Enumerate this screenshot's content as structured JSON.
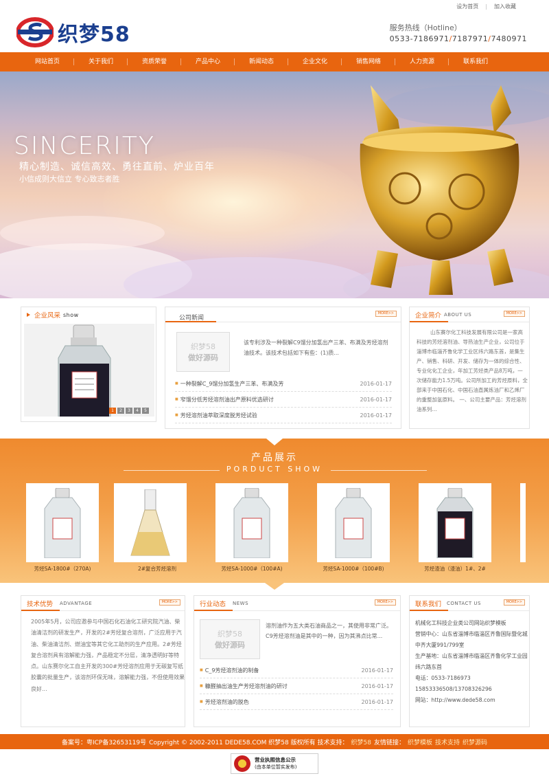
{
  "topbar": {
    "home": "设为首页",
    "fav": "加入收藏"
  },
  "logo": {
    "text": "织梦58"
  },
  "hotline": {
    "label": "服务热线（Hotline）",
    "prefix": "0533-",
    "n1": "7186971",
    "n2": "7187971",
    "n3": "7480971"
  },
  "nav": [
    "网站首页",
    "关于我们",
    "资质荣誉",
    "产品中心",
    "新闻动态",
    "企业文化",
    "销售网络",
    "人力资源",
    "联系我们"
  ],
  "banner": {
    "title": "SINCERITY",
    "sub1": "精心制造、诚信高效、勇往直前、炉业百年",
    "sub2": "小信成则大信立 专心致志者胜"
  },
  "show": {
    "title": "企业风采",
    "en": "show",
    "pages": [
      "1",
      "2",
      "3",
      "4",
      "5"
    ]
  },
  "news": {
    "title": "公司新闻",
    "more": "MORE>>",
    "thumb1": "织梦58",
    "thumb2": "做好源码",
    "desc": "该专利涉及一种裂解C9馏分加氢出产三苯、布满及芳烃溶剂油技术。该技术包括如下有些：(1)质...",
    "items": [
      {
        "t": "一种裂解C_9馏分加氢生产三苯、布满及芳",
        "d": "2016-01-17"
      },
      {
        "t": "窄馏分低芳烃溶剂油出产原料优选研讨",
        "d": "2016-01-17"
      },
      {
        "t": "芳烃溶剂油萃取深度脱芳烃试验",
        "d": "2016-01-17"
      }
    ]
  },
  "about": {
    "title": "企业简介",
    "en": "ABOUT US",
    "more": "MORE>>",
    "text": "山东赛尔化工科技发展有限公司是一家高科技的芳烃溶剂油、导热油生产企业，公司位于淄博市临淄齐鲁化学工业区纬六路东首，是集生产、销售、科研、开发、储存为一体的综合性、专业化化工企业，年加工芳烃类产品8万吨，一次储存能力1.5万吨。公司所加工的芳烃原料，全部来于中国石化、中国石油直属炼油厂和乙烯厂的重整加氢原料。 一、公司主要产品：芳烃溶剂油系列..."
  },
  "products": {
    "title": "产品展示",
    "en": "PORDUCT SHOW",
    "items": [
      {
        "name": "芳烃SA-1800#（270A)"
      },
      {
        "name": "2#复合芳烃溶剂"
      },
      {
        "name": "芳烃SA-1000#（100#A)"
      },
      {
        "name": "芳烃SA-1000#（100#B)"
      },
      {
        "name": "芳烃渣油（渣油）1#、2#"
      }
    ]
  },
  "adv": {
    "title": "技术优势",
    "en": "ADVANTAGE",
    "more": "MORE>>",
    "text": "2005年5月，公司应邀参与中国石化石油化工研究院汽油、柴油清洁剂的研发生产，开发的2#芳烃复合溶剂，广泛应用于汽油、柴油清洁剂、燃油宝等其它化工助剂的生产应用。2#芳烃复合溶剂具有溶解能力强，产品稳定不分层，清净透明好等特点。山东赛尔化工自主开发的300#芳烃溶剂应用于无碳复写纸胶囊的批量生产，该溶剂环保无味，溶解能力强，不但使用效果良好..."
  },
  "industry": {
    "title": "行业动态",
    "en": "NEWS",
    "more": "MORE>>",
    "thumb1": "织梦58",
    "thumb2": "做好源码",
    "desc": "溶剂油作为五大类石油商品之一，其使用非常广泛。C9芳烃溶剂油是其中的一种，因为其沸点比常...",
    "items": [
      {
        "t": "C_9芳烃溶剂油的制备",
        "d": "2016-01-17"
      },
      {
        "t": "糠醛抽出油生产芳烃溶剂油的研讨",
        "d": "2016-01-17"
      },
      {
        "t": "芳烃溶剂油的脱色",
        "d": "2016-01-17"
      }
    ]
  },
  "contact": {
    "title": "联系我们",
    "en": "CONTACT US",
    "more": "MORE>>",
    "lines": [
      "机械化工科技企业类公司网站织梦模板",
      "营销中心：山东省淄博市临淄区齐鲁国际暨化城中齐大厦991/799室",
      "生产基地：山东省淄博市临淄区齐鲁化学工业园纬六路东首",
      "电话：0533-7186973",
      "15853336508/13708326296",
      "网站：http://www.dede58.com"
    ]
  },
  "footer": {
    "icp": "备案号：粤ICP备32653119号",
    "copy": "Copyright © 2002-2011 DEDE58.COM 织梦58 版权所有 技术支持：",
    "tech": "织梦58",
    "links_label": "友情链接：",
    "links": [
      "织梦模板",
      "技术支持",
      "织梦源码"
    ]
  },
  "license": {
    "l1": "营业执照信息公示",
    "l2": "(由本单位暂实发布)"
  },
  "colors": {
    "accent": "#e8650f",
    "brand_blue": "#1b3f8f"
  }
}
